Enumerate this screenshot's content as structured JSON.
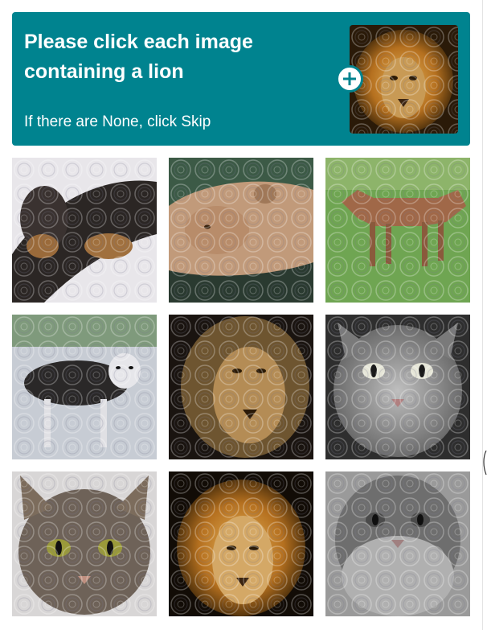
{
  "challenge": {
    "prompt": "Please click each image containing a lion",
    "skip_hint": "If there are None, click Skip",
    "example_image": "lion",
    "expand_icon": "plus-icon"
  },
  "colors": {
    "header_bg": "#00838f",
    "header_text": "#ffffff"
  },
  "tiles": [
    {
      "subject": "dog"
    },
    {
      "subject": "lioness"
    },
    {
      "subject": "dog"
    },
    {
      "subject": "husky"
    },
    {
      "subject": "lion"
    },
    {
      "subject": "cat"
    },
    {
      "subject": "cat"
    },
    {
      "subject": "lion"
    },
    {
      "subject": "cat"
    }
  ]
}
